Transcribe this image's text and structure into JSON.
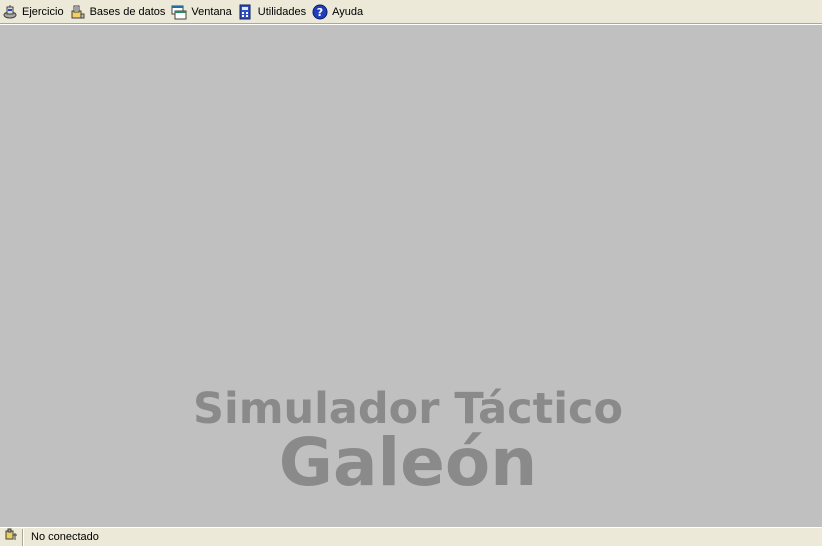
{
  "menubar": {
    "items": [
      {
        "label": "Ejercicio",
        "icon": "simulation-icon"
      },
      {
        "label": "Bases de datos",
        "icon": "database-icon"
      },
      {
        "label": "Ventana",
        "icon": "window-icon"
      },
      {
        "label": "Utilidades",
        "icon": "tools-icon"
      },
      {
        "label": "Ayuda",
        "icon": "help-icon"
      }
    ]
  },
  "workspace": {
    "watermark_title": "Simulador Táctico",
    "watermark_subtitle": "Galeón"
  },
  "statusbar": {
    "icon": "connection-icon",
    "text": "No conectado"
  },
  "colors": {
    "menubar_bg": "#ece9d8",
    "workspace_bg": "#c0c0c0",
    "watermark": "#8a8a8a",
    "help_blue": "#1f3fbf"
  }
}
